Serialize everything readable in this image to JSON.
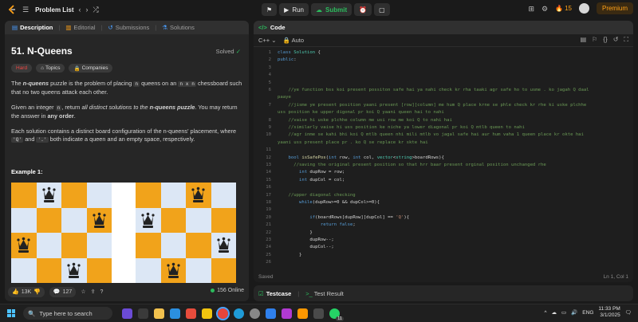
{
  "topbar": {
    "title": "Problem List",
    "run_label": "Run",
    "submit_label": "Submit",
    "streak": "15",
    "premium_label": "Premium"
  },
  "left_tabs": [
    {
      "label": "Description"
    },
    {
      "label": "Editorial"
    },
    {
      "label": "Submissions"
    },
    {
      "label": "Solutions"
    }
  ],
  "problem": {
    "title": "51. N-Queens",
    "status": "Solved",
    "difficulty": "Hard",
    "tags_label": "Topics",
    "companies_label": "Companies",
    "p1_a": "The ",
    "p1_b": "n-queens",
    "p1_c": " puzzle is the problem of placing ",
    "p1_n": "n",
    "p1_d": " queens on an ",
    "p1_nxn": "n x n",
    "p1_e": " chessboard such that no two queens attack each other.",
    "p2_a": "Given an integer ",
    "p2_n": "n",
    "p2_b": ", return ",
    "p2_c": "all distinct solutions to the ",
    "p2_d": "n-queens puzzle",
    "p2_e": ". You may return the answer in ",
    "p2_f": "any order",
    "p2_g": ".",
    "p3_a": "Each solution contains a distinct board configuration of the n-queens' placement, where ",
    "p3_q": "'Q'",
    "p3_b": " and ",
    "p3_dot": "'.'",
    "p3_c": " both indicate a queen and an empty space, respectively.",
    "example_label": "Example 1:"
  },
  "boards": [
    {
      "queens": [
        [
          0,
          1
        ],
        [
          1,
          3
        ],
        [
          2,
          0
        ],
        [
          3,
          2
        ]
      ]
    },
    {
      "queens": [
        [
          0,
          2
        ],
        [
          1,
          0
        ],
        [
          2,
          3
        ],
        [
          3,
          1
        ]
      ]
    }
  ],
  "left_footer": {
    "likes": "13K",
    "comments": "127",
    "online": "156 Online"
  },
  "code_panel": {
    "tab_label": "Code",
    "language": "C++",
    "mode": "Auto",
    "status_left": "Saved",
    "status_right": "Ln 1, Col 1"
  },
  "code_lines": [
    {
      "n": "1",
      "t": "class Solution {"
    },
    {
      "n": "2",
      "t": "public:"
    },
    {
      "n": "3",
      "t": ""
    },
    {
      "n": "4",
      "t": ""
    },
    {
      "n": "5",
      "t": ""
    },
    {
      "n": "6",
      "t": "    //ye function bss koi present possiton safe hai ya nahi check kr rha taaki agr safe ho to usme . ko jagah Q daal"
    },
    {
      "n": "",
      "t": "paaye"
    },
    {
      "n": "7",
      "t": "    //jisme ye present position yaani present [row][column] me hum Q place krne se phle check kr rhe ki uske plchhe"
    },
    {
      "n": "",
      "t": "uss position ke upper digonal pr koi Q yaani queen hai to nahi"
    },
    {
      "n": "8",
      "t": "    //vaise hi uske plchhe column me usi row me koi Q to nahi hai"
    },
    {
      "n": "9",
      "t": "    //similarly vaise hi uss position ke niche ya lower diagonal pr koi Q mtlb queen to nahi"
    },
    {
      "n": "10",
      "t": "    //agr inme se kahi bhi koi Q mtlb queen nhi mili mtlb vo jagal safe hai aur hum vaha 1 queen place kr okte hai"
    },
    {
      "n": "",
      "t": "yaani uss present place pr . ko Q se replace kr skte hai"
    },
    {
      "n": "11",
      "t": ""
    },
    {
      "n": "12",
      "t": "    bool isSafePos(int row, int col, vector<string>boardRows){"
    },
    {
      "n": "13",
      "t": "      //saving the original present position so that hrr baar present orginal position unchanged rhe"
    },
    {
      "n": "14",
      "t": "        int dupRow = row;"
    },
    {
      "n": "15",
      "t": "        int dupCol = col;"
    },
    {
      "n": "16",
      "t": ""
    },
    {
      "n": "17",
      "t": "    //upper diagonal checking"
    },
    {
      "n": "18",
      "t": "        while(dupRow>=0 && dupCol>=0){"
    },
    {
      "n": "19",
      "t": ""
    },
    {
      "n": "20",
      "t": "            if(boardRows[dupRow][dupCol] == 'Q'){"
    },
    {
      "n": "21",
      "t": "                return false;"
    },
    {
      "n": "22",
      "t": "            }"
    },
    {
      "n": "23",
      "t": "            dupRow--;"
    },
    {
      "n": "24",
      "t": "            dupCol--;"
    },
    {
      "n": "25",
      "t": "        }"
    },
    {
      "n": "26",
      "t": ""
    }
  ],
  "test_panel": {
    "testcase_label": "Testcase",
    "result_label": "Test Result"
  },
  "taskbar": {
    "search_placeholder": "Type here to search",
    "badge": "11",
    "lang": "ENG",
    "time": "11:33 PM",
    "date": "3/1/2025"
  }
}
